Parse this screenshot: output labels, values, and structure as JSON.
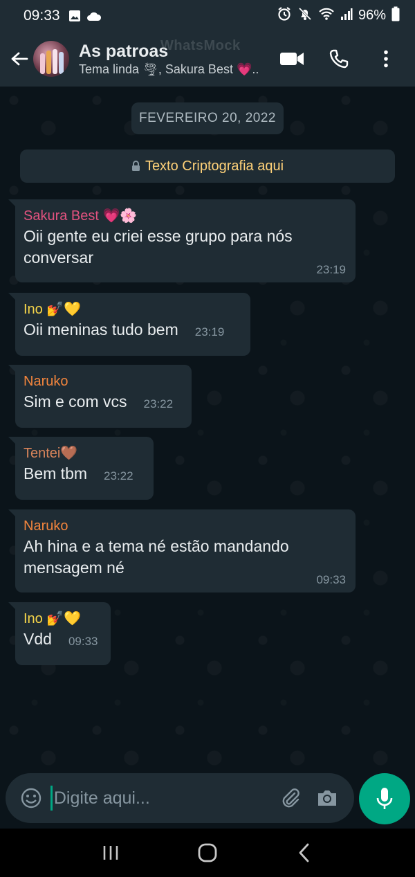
{
  "status_bar": {
    "time": "09:33",
    "battery": "96%",
    "icons": [
      "gallery-icon",
      "cloud-icon",
      "alarm-icon",
      "mute-icon",
      "wifi-icon",
      "signal-icon",
      "battery-icon"
    ]
  },
  "header": {
    "group_name": "As patroas",
    "members": "Tema linda 🌪, Sakura Best 💗..",
    "watermark": "WhatsMock"
  },
  "date_chip": "FEVEREIRO 20, 2022",
  "encryption_note": "Texto Criptografia aqui",
  "messages": [
    {
      "sender": "Sakura Best 💗🌸",
      "sender_color": "#e2527f",
      "text": "Oii gente eu criei esse grupo para nós conversar",
      "time": "23:19"
    },
    {
      "sender": "Ino 💅💛",
      "sender_color": "#f7d64a",
      "text": "Oii meninas tudo bem",
      "time": "23:19"
    },
    {
      "sender": "Naruko",
      "sender_color": "#f2853d",
      "text": "Sim e com vcs",
      "time": "23:22"
    },
    {
      "sender": "Tentei🤎",
      "sender_color": "#d9855b",
      "text": "Bem tbm",
      "time": "23:22"
    },
    {
      "sender": "Naruko",
      "sender_color": "#f2853d",
      "text": "Ah hina e a tema né estão mandando mensagem né",
      "time": "09:33"
    },
    {
      "sender": "Ino 💅💛",
      "sender_color": "#f7d64a",
      "text": "Vdd",
      "time": "09:33"
    }
  ],
  "input": {
    "placeholder": "Digite aqui..."
  },
  "colors": {
    "accent": "#00a884",
    "bubble": "#1f2c34",
    "background": "#0b141a",
    "encryption_text": "#ffd279"
  }
}
